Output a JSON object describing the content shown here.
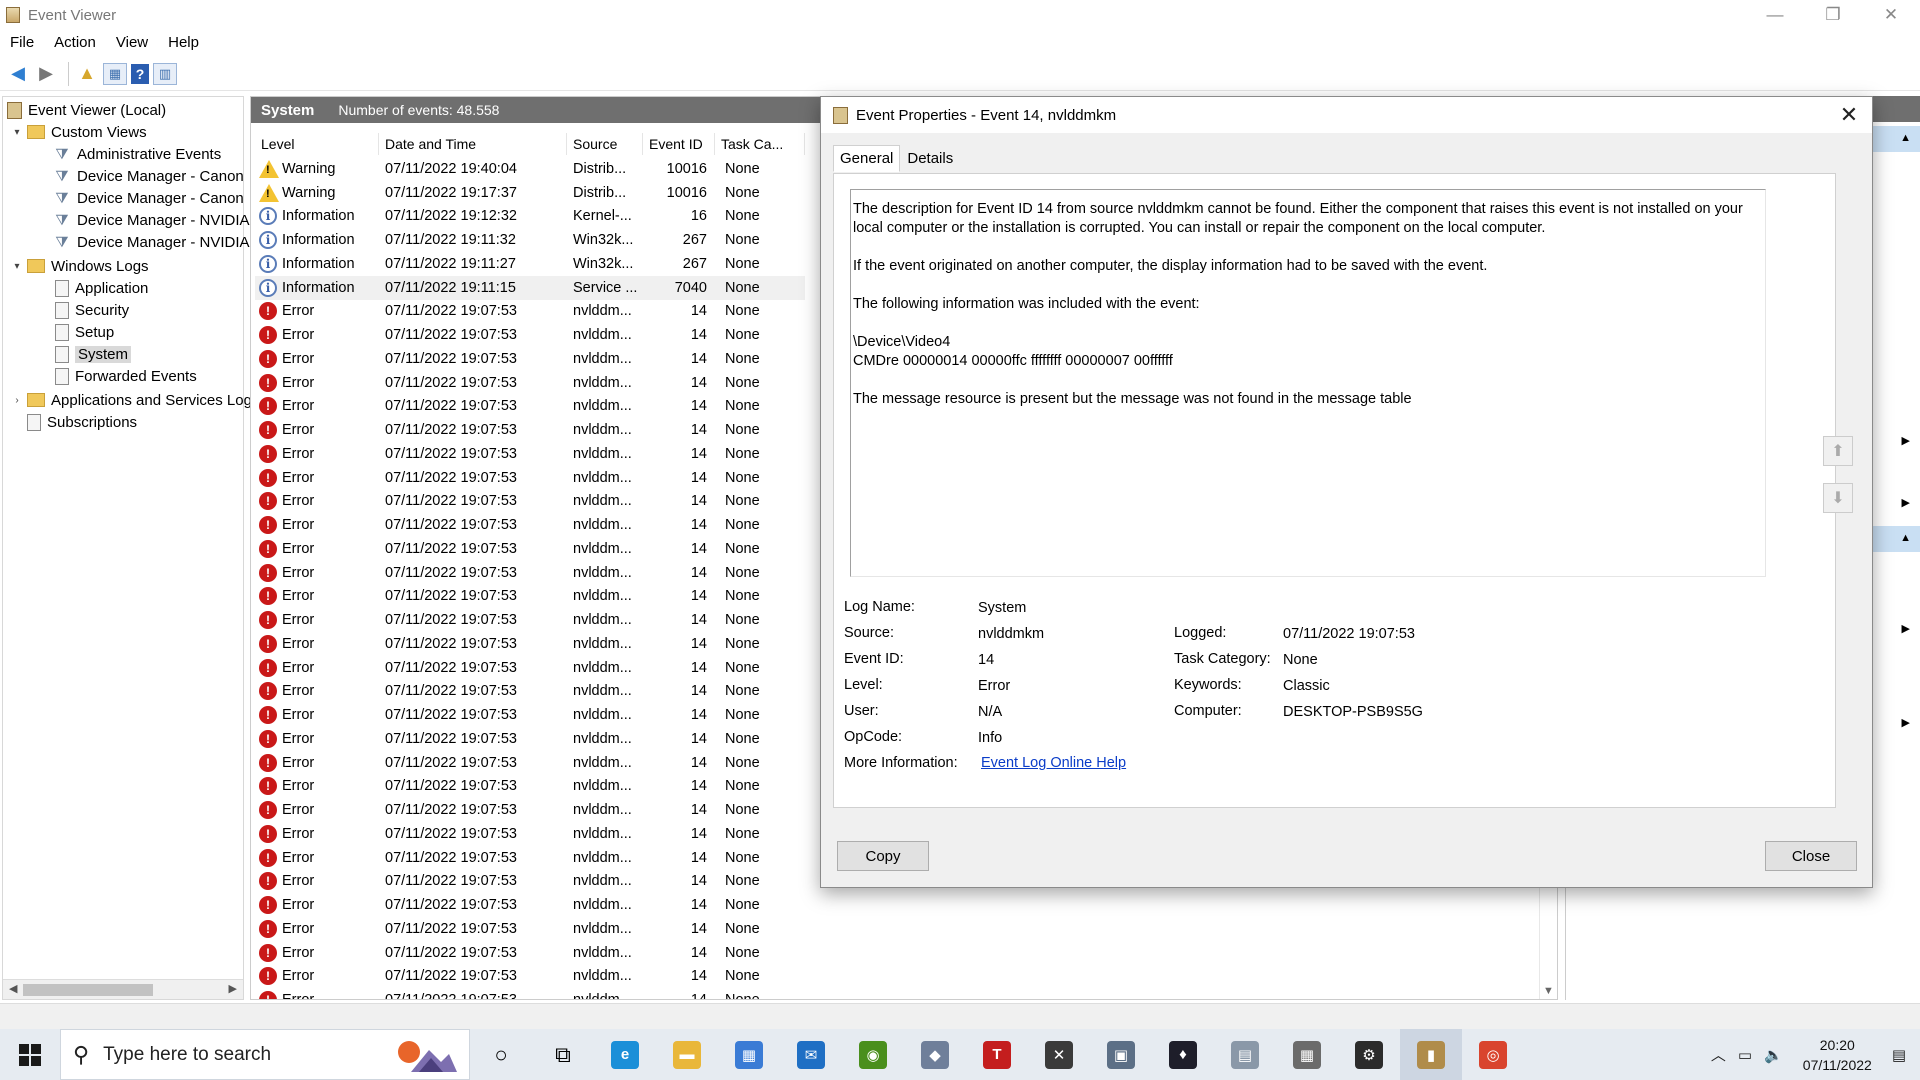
{
  "window": {
    "title": "Event Viewer",
    "minimize": "—",
    "restore": "❐",
    "close": "✕"
  },
  "menu": [
    "File",
    "Action",
    "View",
    "Help"
  ],
  "toolbar": {
    "back": "◀",
    "forward": "▶",
    "up": "▲",
    "show_hide": "▦",
    "help": "?",
    "properties": "▥"
  },
  "tree": {
    "root": "Event Viewer (Local)",
    "custom_views": "Custom Views",
    "custom_items": [
      "Administrative Events",
      "Device Manager - Canon",
      "Device Manager - Canon",
      "Device Manager - NVIDIA",
      "Device Manager - NVIDIA"
    ],
    "windows_logs": "Windows Logs",
    "log_items": [
      "Application",
      "Security",
      "Setup",
      "System",
      "Forwarded Events"
    ],
    "apps_services": "Applications and Services Log",
    "subscriptions": "Subscriptions",
    "expand_open": "▾",
    "expand_closed": "›"
  },
  "list": {
    "pane_name": "System",
    "event_count": "Number of events: 48.558",
    "columns": [
      "Level",
      "Date and Time",
      "Source",
      "Event ID",
      "Task Ca..."
    ],
    "rows": [
      {
        "level": "Warning",
        "type": "warning",
        "date": "07/11/2022 19:40:04",
        "source": "Distrib...",
        "id": "10016",
        "task": "None"
      },
      {
        "level": "Warning",
        "type": "warning",
        "date": "07/11/2022 19:17:37",
        "source": "Distrib...",
        "id": "10016",
        "task": "None"
      },
      {
        "level": "Information",
        "type": "info",
        "date": "07/11/2022 19:12:32",
        "source": "Kernel-...",
        "id": "16",
        "task": "None"
      },
      {
        "level": "Information",
        "type": "info",
        "date": "07/11/2022 19:11:32",
        "source": "Win32k...",
        "id": "267",
        "task": "None"
      },
      {
        "level": "Information",
        "type": "info",
        "date": "07/11/2022 19:11:27",
        "source": "Win32k...",
        "id": "267",
        "task": "None"
      },
      {
        "level": "Information",
        "type": "info",
        "date": "07/11/2022 19:11:15",
        "source": "Service ...",
        "id": "7040",
        "task": "None"
      },
      {
        "level": "Error",
        "type": "error",
        "date": "07/11/2022 19:07:53",
        "source": "nvlddm...",
        "id": "14",
        "task": "None"
      },
      {
        "level": "Error",
        "type": "error",
        "date": "07/11/2022 19:07:53",
        "source": "nvlddm...",
        "id": "14",
        "task": "None"
      },
      {
        "level": "Error",
        "type": "error",
        "date": "07/11/2022 19:07:53",
        "source": "nvlddm...",
        "id": "14",
        "task": "None"
      },
      {
        "level": "Error",
        "type": "error",
        "date": "07/11/2022 19:07:53",
        "source": "nvlddm...",
        "id": "14",
        "task": "None"
      },
      {
        "level": "Error",
        "type": "error",
        "date": "07/11/2022 19:07:53",
        "source": "nvlddm...",
        "id": "14",
        "task": "None"
      },
      {
        "level": "Error",
        "type": "error",
        "date": "07/11/2022 19:07:53",
        "source": "nvlddm...",
        "id": "14",
        "task": "None"
      },
      {
        "level": "Error",
        "type": "error",
        "date": "07/11/2022 19:07:53",
        "source": "nvlddm...",
        "id": "14",
        "task": "None"
      },
      {
        "level": "Error",
        "type": "error",
        "date": "07/11/2022 19:07:53",
        "source": "nvlddm...",
        "id": "14",
        "task": "None"
      },
      {
        "level": "Error",
        "type": "error",
        "date": "07/11/2022 19:07:53",
        "source": "nvlddm...",
        "id": "14",
        "task": "None"
      },
      {
        "level": "Error",
        "type": "error",
        "date": "07/11/2022 19:07:53",
        "source": "nvlddm...",
        "id": "14",
        "task": "None"
      },
      {
        "level": "Error",
        "type": "error",
        "date": "07/11/2022 19:07:53",
        "source": "nvlddm...",
        "id": "14",
        "task": "None"
      },
      {
        "level": "Error",
        "type": "error",
        "date": "07/11/2022 19:07:53",
        "source": "nvlddm...",
        "id": "14",
        "task": "None"
      },
      {
        "level": "Error",
        "type": "error",
        "date": "07/11/2022 19:07:53",
        "source": "nvlddm...",
        "id": "14",
        "task": "None"
      },
      {
        "level": "Error",
        "type": "error",
        "date": "07/11/2022 19:07:53",
        "source": "nvlddm...",
        "id": "14",
        "task": "None"
      },
      {
        "level": "Error",
        "type": "error",
        "date": "07/11/2022 19:07:53",
        "source": "nvlddm...",
        "id": "14",
        "task": "None"
      },
      {
        "level": "Error",
        "type": "error",
        "date": "07/11/2022 19:07:53",
        "source": "nvlddm...",
        "id": "14",
        "task": "None"
      },
      {
        "level": "Error",
        "type": "error",
        "date": "07/11/2022 19:07:53",
        "source": "nvlddm...",
        "id": "14",
        "task": "None"
      },
      {
        "level": "Error",
        "type": "error",
        "date": "07/11/2022 19:07:53",
        "source": "nvlddm...",
        "id": "14",
        "task": "None"
      },
      {
        "level": "Error",
        "type": "error",
        "date": "07/11/2022 19:07:53",
        "source": "nvlddm...",
        "id": "14",
        "task": "None"
      },
      {
        "level": "Error",
        "type": "error",
        "date": "07/11/2022 19:07:53",
        "source": "nvlddm...",
        "id": "14",
        "task": "None"
      },
      {
        "level": "Error",
        "type": "error",
        "date": "07/11/2022 19:07:53",
        "source": "nvlddm...",
        "id": "14",
        "task": "None"
      },
      {
        "level": "Error",
        "type": "error",
        "date": "07/11/2022 19:07:53",
        "source": "nvlddm...",
        "id": "14",
        "task": "None"
      },
      {
        "level": "Error",
        "type": "error",
        "date": "07/11/2022 19:07:53",
        "source": "nvlddm...",
        "id": "14",
        "task": "None"
      },
      {
        "level": "Error",
        "type": "error",
        "date": "07/11/2022 19:07:53",
        "source": "nvlddm...",
        "id": "14",
        "task": "None"
      },
      {
        "level": "Error",
        "type": "error",
        "date": "07/11/2022 19:07:53",
        "source": "nvlddm...",
        "id": "14",
        "task": "None"
      },
      {
        "level": "Error",
        "type": "error",
        "date": "07/11/2022 19:07:53",
        "source": "nvlddm...",
        "id": "14",
        "task": "None"
      },
      {
        "level": "Error",
        "type": "error",
        "date": "07/11/2022 19:07:53",
        "source": "nvlddm...",
        "id": "14",
        "task": "None"
      },
      {
        "level": "Error",
        "type": "error",
        "date": "07/11/2022 19:07:53",
        "source": "nvlddm...",
        "id": "14",
        "task": "None"
      },
      {
        "level": "Error",
        "type": "error",
        "date": "07/11/2022 19:07:53",
        "source": "nvlddm...",
        "id": "14",
        "task": "None"
      },
      {
        "level": "Error",
        "type": "error",
        "date": "07/11/2022 19:07:53",
        "source": "nvlddm...",
        "id": "14",
        "task": "None"
      }
    ],
    "selected_row": 5,
    "icon_glyphs": {
      "error": "!",
      "warning": "!",
      "info": "i"
    }
  },
  "dialog": {
    "title": "Event Properties - Event 14, nvlddmkm",
    "close_glyph": "✕",
    "tabs": [
      "General",
      "Details"
    ],
    "description": [
      "The description for Event ID 14 from source nvlddmkm cannot be found. Either the component that raises this event is not installed on your local computer or the installation is corrupted. You can install or repair the component on the local computer.",
      "If the event originated on another computer, the display information had to be saved with the event.",
      "The following information was included with the event:",
      "\\Device\\Video4\nCMDre 00000014 00000ffc ffffffff 00000007 00ffffff",
      "The message resource is present but the message was not found in the message table"
    ],
    "scroll_up": "⬆",
    "scroll_down": "⬇",
    "fields": {
      "log_name_label": "Log Name:",
      "log_name": "System",
      "source_label": "Source:",
      "source": "nvlddmkm",
      "logged_label": "Logged:",
      "logged": "07/11/2022 19:07:53",
      "event_id_label": "Event ID:",
      "event_id": "14",
      "task_category_label": "Task Category:",
      "task_category": "None",
      "level_label": "Level:",
      "level": "Error",
      "keywords_label": "Keywords:",
      "keywords": "Classic",
      "user_label": "User:",
      "user": "N/A",
      "computer_label": "Computer:",
      "computer": "DESKTOP-PSB9S5G",
      "opcode_label": "OpCode:",
      "opcode": "Info",
      "more_info_label": "More Information:",
      "more_info_link": "Event Log Online Help"
    },
    "copy_button": "Copy",
    "close_button": "Close"
  },
  "actions_pane": {
    "collapse_up": "▲",
    "expand_right": "▶"
  },
  "taskbar": {
    "search_placeholder": "Type here to search",
    "search_glyph": "⚲",
    "cortana_glyph": "○",
    "taskview_glyph": "⧉",
    "apps": [
      {
        "name": "edge-app-icon",
        "glyph": "e",
        "color": "#1b8fd8"
      },
      {
        "name": "file-explorer-app-icon",
        "glyph": "▬",
        "color": "#e9b73a"
      },
      {
        "name": "store-app-icon",
        "glyph": "▦",
        "color": "#3a7bd5"
      },
      {
        "name": "mail-app-icon",
        "glyph": "✉",
        "color": "#1f6fc4"
      },
      {
        "name": "nvidia-app-icon",
        "glyph": "◉",
        "color": "#4a8f1d"
      },
      {
        "name": "virtualbox-app-icon",
        "glyph": "◆",
        "color": "#6f7f9a"
      },
      {
        "name": "t-app-icon",
        "glyph": "T",
        "color": "#c41e1e"
      },
      {
        "name": "xbox-app-icon",
        "glyph": "✕",
        "color": "#3a3a3a"
      },
      {
        "name": "device-app-icon",
        "glyph": "▣",
        "color": "#5c6f86"
      },
      {
        "name": "predator-app-icon",
        "glyph": "♦",
        "color": "#1e1e2a"
      },
      {
        "name": "printer-app-icon",
        "glyph": "▤",
        "color": "#8a98a8"
      },
      {
        "name": "network-app-icon",
        "glyph": "▦",
        "color": "#6b6b6b"
      },
      {
        "name": "settings-app-icon",
        "glyph": "⚙",
        "color": "#2b2b2b"
      },
      {
        "name": "event-viewer-app-icon",
        "glyph": "▮",
        "color": "#b08c4a"
      },
      {
        "name": "chrome-app-icon",
        "glyph": "◎",
        "color": "#d9442e"
      }
    ],
    "tray": {
      "chevron": "︿",
      "battery": "▭",
      "volume": "🔈",
      "time": "20:20",
      "date": "07/11/2022",
      "notifications": "▤"
    }
  }
}
